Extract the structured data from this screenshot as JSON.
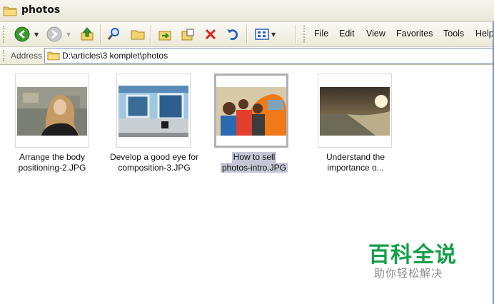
{
  "window": {
    "title": "photos"
  },
  "toolbar": {
    "buttons": [
      {
        "name": "back-button",
        "icon": "back-arrow-icon"
      },
      {
        "name": "forward-button",
        "icon": "forward-arrow-icon"
      },
      {
        "name": "up-folder-button",
        "icon": "up-folder-icon"
      },
      {
        "name": "search-button",
        "icon": "search-icon"
      },
      {
        "name": "folders-button",
        "icon": "folders-icon"
      },
      {
        "name": "move-to-button",
        "icon": "move-to-icon"
      },
      {
        "name": "copy-to-button",
        "icon": "copy-to-icon"
      },
      {
        "name": "delete-button",
        "icon": "delete-icon"
      },
      {
        "name": "undo-button",
        "icon": "undo-icon"
      },
      {
        "name": "views-button",
        "icon": "views-icon"
      }
    ],
    "colors": {
      "back": "#3a9a2e",
      "delete": "#e02020",
      "undo": "#2a5fc0"
    }
  },
  "menu": [
    "File",
    "Edit",
    "View",
    "Favorites",
    "Tools",
    "Help"
  ],
  "address": {
    "label": "Address",
    "path": "D:\\articles\\3 komplet\\photos"
  },
  "files": [
    {
      "line1": "Arrange the body",
      "line2": "positioning-2.JPG",
      "selected": false
    },
    {
      "line1": "Develop a good eye for",
      "line2": "composition-3.JPG",
      "selected": false
    },
    {
      "line1": "How to sell",
      "line2": "photos-intro.JPG",
      "selected": true
    },
    {
      "line1": "Understand the",
      "line2": "importance o...",
      "selected": false
    }
  ],
  "watermark": {
    "title": "百科全说",
    "subtitle": "助你轻松解决",
    "color": "#14a04a"
  }
}
